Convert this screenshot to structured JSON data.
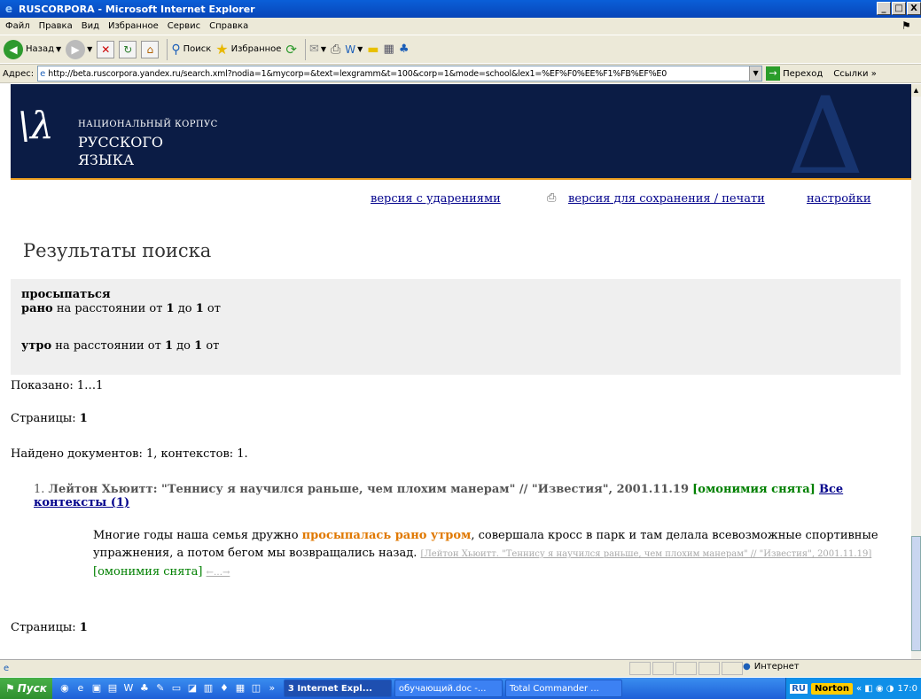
{
  "window": {
    "title": "RUSCORPORA - Microsoft Internet Explorer",
    "min": "_",
    "max": "□",
    "close": "X"
  },
  "menu": [
    "Файл",
    "Правка",
    "Вид",
    "Избранное",
    "Сервис",
    "Справка"
  ],
  "toolbar": {
    "back": "Назад",
    "search": "Поиск",
    "favorites": "Избранное"
  },
  "address": {
    "label": "Адрес:",
    "url": "http://beta.ruscorpora.yandex.ru/search.xml?nodia=1&mycorp=&text=lexgramm&t=100&corp=1&mode=school&lex1=%EF%F0%EE%F1%FB%EF%E0",
    "go": "Переход",
    "links": "Ссылки »"
  },
  "header": {
    "line1": "НАЦИОНАЛЬНЫЙ КОРПУС",
    "line2": "РУССКОГО",
    "line3": "ЯЗЫКА"
  },
  "nav": {
    "accents": "версия с ударениями",
    "print": "версия для сохранения / печати",
    "settings": "настройки"
  },
  "page_title": "Результаты поиска",
  "query": {
    "w1": "просыпаться",
    "w2": "рано",
    "w3": "утро",
    "dist_pre": "на расстоянии от",
    "from": "1",
    "mid": "до",
    "to": "1",
    "suffix": "от"
  },
  "shown": "Показано: 1…1",
  "pages_label": "Страницы:",
  "pages_num": "1",
  "found": "Найдено документов: 1, контекстов: 1.",
  "result": {
    "num": "1.",
    "title": "Лейтон Хьюитт: \"Теннису я научился раньше, чем плохим манерам\" // \"Известия\", 2001.11.19",
    "homonymy": "[омонимия снята]",
    "all_contexts": "Все контексты (1)",
    "context_pre": "Многие годы наша семья дружно ",
    "context_hit": "просыпалась рано утром",
    "context_post": ", совершала кросс в парк и там делала всевозможные спортивные упражнения, а потом бегом мы возвращались назад.",
    "source": "[Лейтон Хьюитт. \"Теннису я научился раньше, чем плохим манерам\" // \"Известия\", 2001.11.19]",
    "homonymy2": "[омонимия снята]",
    "arrows": "←…→"
  },
  "status": {
    "zone": "Интернет"
  },
  "taskbar": {
    "start": "Пуск",
    "tasks": [
      "3 Internet Expl...",
      "обучающий.doc -...",
      "Total Commander ..."
    ],
    "norton": "Norton",
    "time": "17:0"
  }
}
